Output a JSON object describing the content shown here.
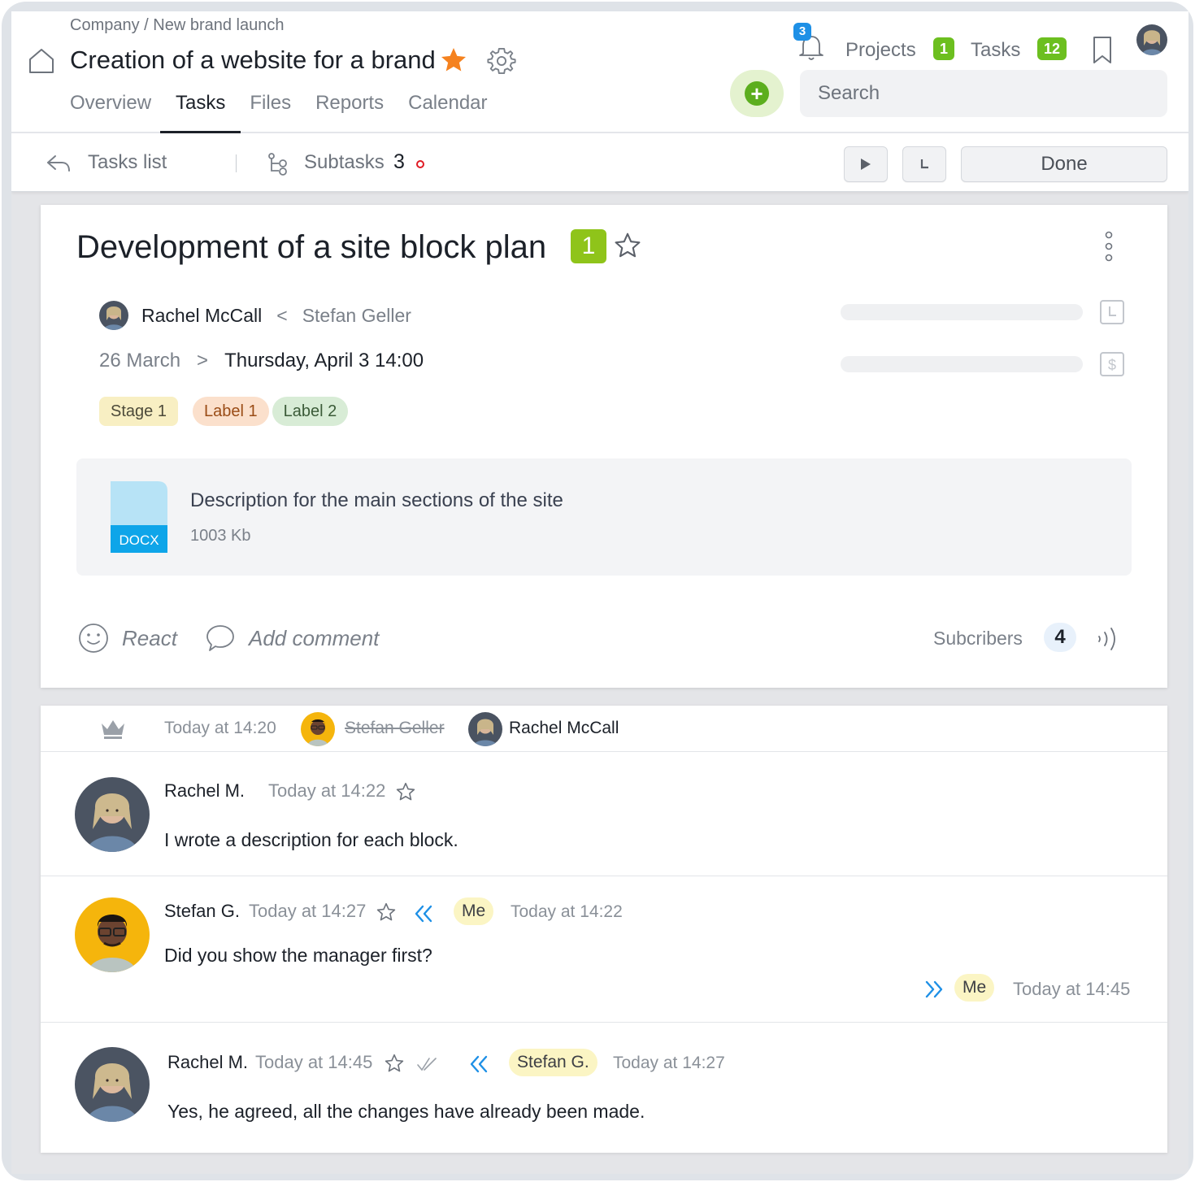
{
  "header": {
    "breadcrumb": "Company / New brand launch",
    "project_title": "Creation of a website for a brand",
    "tabs": [
      {
        "label": "Overview"
      },
      {
        "label": "Tasks",
        "active": true
      },
      {
        "label": "Files"
      },
      {
        "label": "Reports"
      },
      {
        "label": "Calendar"
      }
    ],
    "notifications_count": "3",
    "projects_label": "Projects",
    "projects_count": "1",
    "tasks_label": "Tasks",
    "tasks_count": "12",
    "search_placeholder": "Search"
  },
  "toolbar": {
    "back_label": "Tasks list",
    "subtasks_label": "Subtasks",
    "subtasks_count": "3",
    "done_label": "Done"
  },
  "task": {
    "title": "Development of a site block plan",
    "priority": "1",
    "assignee": "Rachel McCall",
    "arrow_back": "<",
    "assigner": "Stefan Geller",
    "start_date": "26 March",
    "arrow_forward": ">",
    "due_date": "Thursday, April 3 14:00",
    "tags": [
      "Stage 1",
      "Label 1",
      "Label 2"
    ],
    "attachment": {
      "type": "DOCX",
      "name": "Description for the main sections of the site",
      "size": "1003 Kb"
    },
    "react_label": "React",
    "comment_label": "Add comment",
    "subscribers_label": "Subcribers",
    "subscribers_count": "4"
  },
  "activity": {
    "time": "Today at 14:20",
    "previous_assignee": "Stefan Geller",
    "new_assignee": "Rachel McCall"
  },
  "messages": [
    {
      "author": "Rachel M.",
      "time": "Today at 14:22",
      "text": "I wrote a description for each block."
    },
    {
      "author": "Stefan G.",
      "time": "Today at 14:27",
      "reply_to": "Me",
      "reply_time": "Today at 14:22",
      "text": "Did you show the manager first?",
      "forward_to": "Me",
      "forward_time": "Today at 14:45"
    },
    {
      "author": "Rachel M.",
      "time": "Today at 14:45",
      "reply_to": "Stefan G.",
      "reply_time": "Today at 14:27",
      "text": "Yes, he agreed, all the changes have already been made."
    }
  ],
  "colors": {
    "accent_green": "#6cbf1f",
    "priority_badge": "#8fc41a",
    "star_orange": "#f5821f",
    "notification_blue": "#1e90e6",
    "reply_arrow_blue": "#1e90e6",
    "docx_blue": "#0ea5e9"
  },
  "icons": [
    "home-icon",
    "star-icon",
    "gear-icon",
    "bell-icon",
    "bookmark-icon",
    "back-arrow-icon",
    "subtasks-icon",
    "play-icon",
    "clock-icon",
    "more-icon",
    "dollar-icon",
    "docx-icon",
    "smile-icon",
    "comment-icon",
    "sound-icon",
    "crown-icon",
    "reply-arrows-icon",
    "forward-arrows-icon",
    "double-check-icon"
  ]
}
